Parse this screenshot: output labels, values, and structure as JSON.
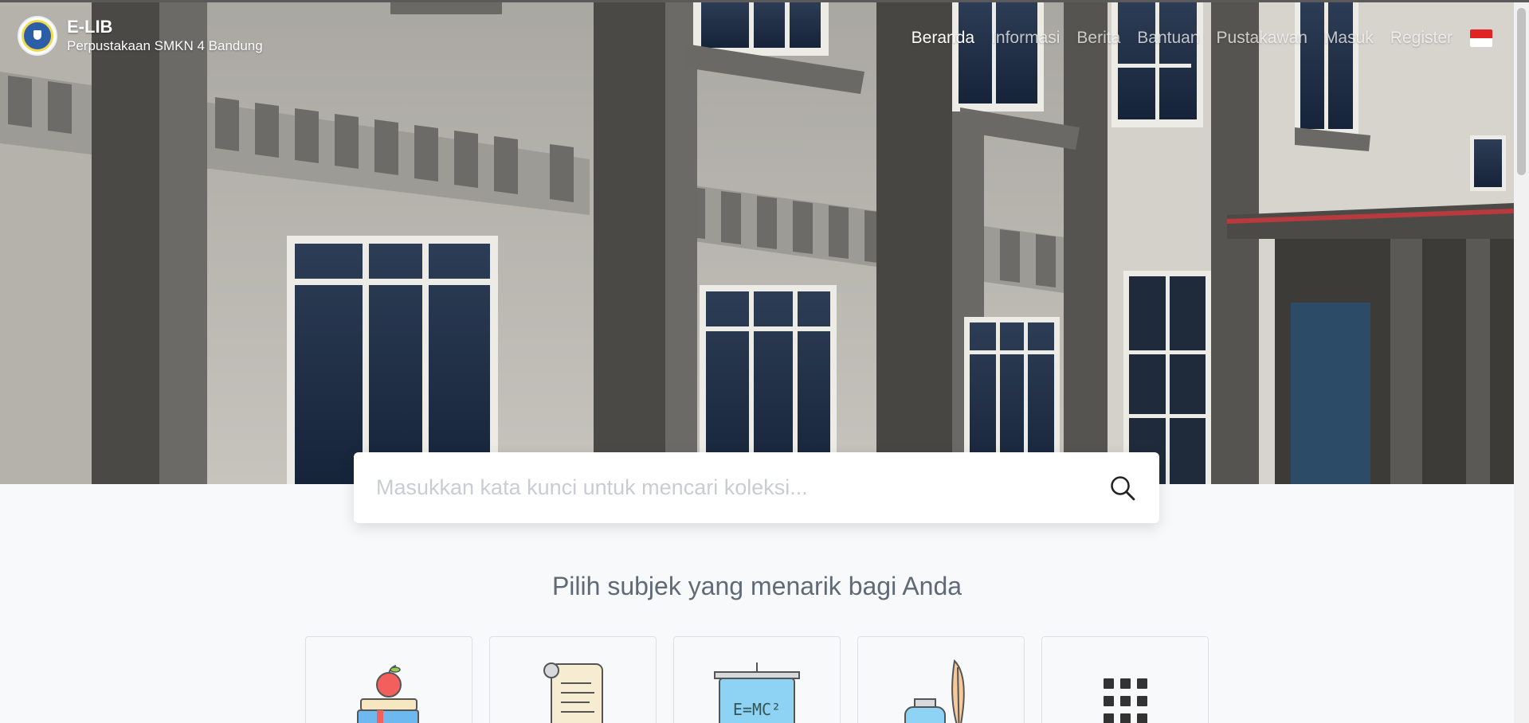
{
  "brand": {
    "title": "E-LIB",
    "subtitle": "Perpustakaan SMKN 4 Bandung",
    "logo_icon": "school-emblem-icon"
  },
  "nav": {
    "items": [
      {
        "label": "Beranda",
        "active": true
      },
      {
        "label": "Informasi",
        "active": false
      },
      {
        "label": "Berita",
        "active": false
      },
      {
        "label": "Bantuan",
        "active": false
      },
      {
        "label": "Pustakawan",
        "active": false
      },
      {
        "label": "Masuk",
        "active": false
      },
      {
        "label": "Register",
        "active": false
      }
    ],
    "language_icon": "indonesia-flag-icon"
  },
  "search": {
    "placeholder": "Masukkan kata kunci untuk mencari koleksi...",
    "value": "",
    "icon": "search-icon"
  },
  "subjects": {
    "heading": "Pilih subjek yang menarik bagi Anda",
    "cards": [
      {
        "icon": "books-apple-icon"
      },
      {
        "icon": "scroll-document-icon"
      },
      {
        "icon": "formula-board-icon"
      },
      {
        "icon": "ink-quill-icon"
      },
      {
        "icon": "grid-more-icon"
      }
    ]
  },
  "colors": {
    "accent_text": "#5f6a76",
    "page_bg": "#f8f9fb",
    "flag_red": "#e02424",
    "flag_white": "#ffffff"
  }
}
